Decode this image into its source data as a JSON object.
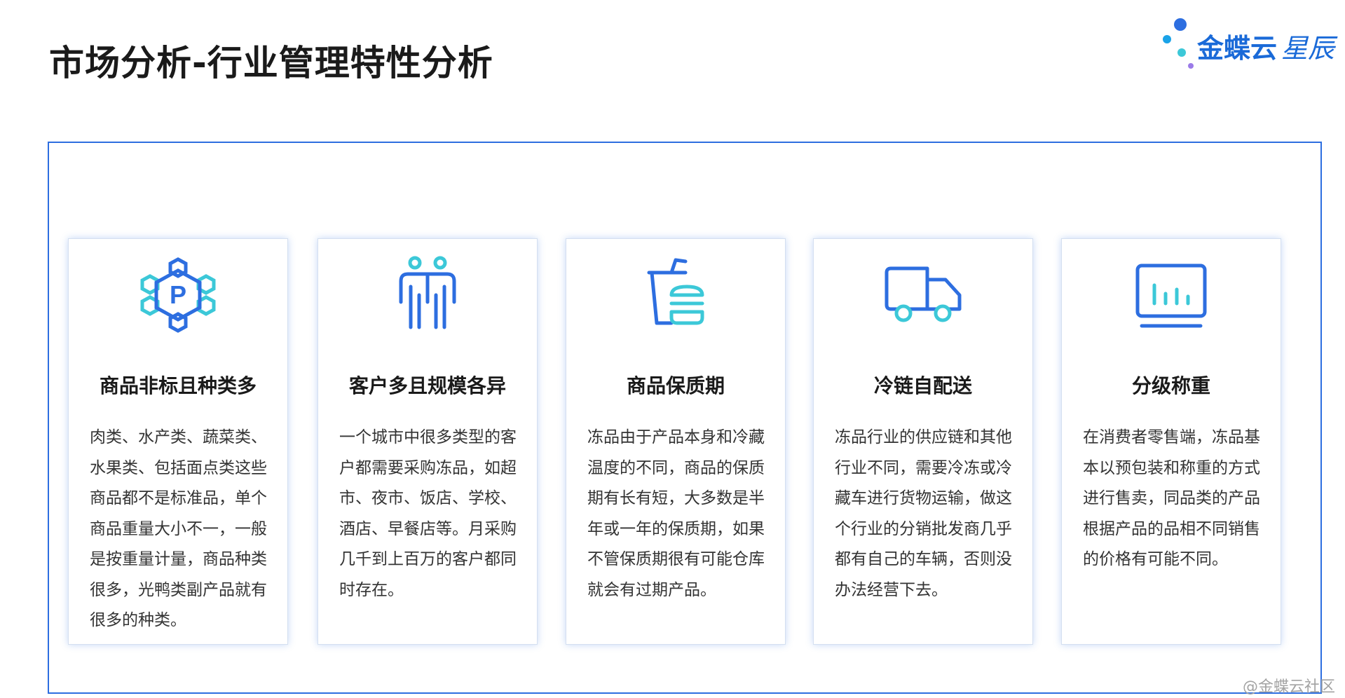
{
  "page_title": "市场分析-行业管理特性分析",
  "logo": {
    "brand": "金蝶云",
    "product": "星辰"
  },
  "colors": {
    "accent_blue": "#2d6ee0",
    "accent_cyan": "#3cc8d8",
    "logo_purple": "#9b7be8"
  },
  "cards": [
    {
      "icon": "hexagon-network-icon",
      "icon_letter": "P",
      "title": "商品非标且种类多",
      "body": "肉类、水产类、蔬菜类、水果类、包括面点类这些商品都不是标准品，单个商品重量大小不一，一般是按重量计量，商品种类很多，光鸭类副产品就有很多的种类。"
    },
    {
      "icon": "people-group-icon",
      "title": "客户多且规模各异",
      "body": "一个城市中很多类型的客户都需要采购冻品，如超市、夜市、饭店、学校、酒店、早餐店等。月采购几千到上百万的客户都同时存在。"
    },
    {
      "icon": "drink-burger-icon",
      "title": "商品保质期",
      "body": "冻品由于产品本身和冷藏温度的不同，商品的保质期有长有短，大多数是半年或一年的保质期，如果不管保质期很有可能仓库就会有过期产品。"
    },
    {
      "icon": "delivery-truck-icon",
      "title": "冷链自配送",
      "body": "冻品行业的供应链和其他行业不同，需要冷冻或冷藏车进行货物运输，做这个行业的分销批发商几乎都有自己的车辆，否则没办法经营下去。"
    },
    {
      "icon": "bar-chart-monitor-icon",
      "title": "分级称重",
      "body": "在消费者零售端，冻品基本以预包装和称重的方式进行售卖，同品类的产品根据产品的品相不同销售的价格有可能不同。"
    }
  ],
  "watermark": "@金蝶云社区"
}
